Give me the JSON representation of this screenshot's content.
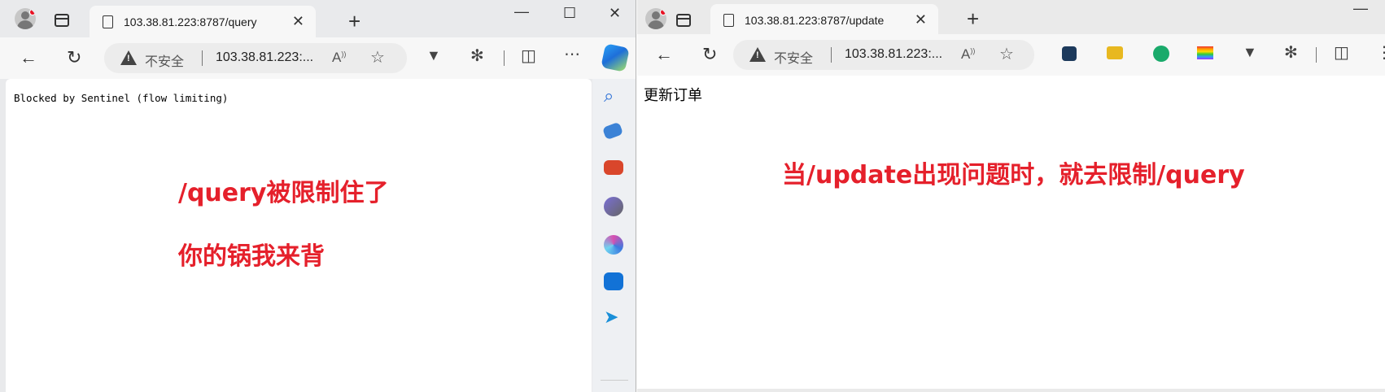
{
  "left_window": {
    "tab_title": "103.38.81.223:8787/query",
    "tab_close": "✕",
    "new_tab": "+",
    "window_controls": {
      "minimize": "—",
      "maximize": "☐",
      "close": "✕"
    },
    "address_bar": {
      "security_label": "不安全",
      "url": "103.38.81.223:...",
      "url_full": "103.38.81.223:8787/query"
    },
    "page_text": "Blocked by Sentinel (flow limiting)",
    "annotations": [
      "/query被限制住了",
      "你的锅我来背"
    ],
    "sidebar_icons": [
      "search-icon",
      "tag-icon",
      "toolbox-icon",
      "games-icon",
      "office-icon",
      "outlook-icon",
      "send-icon"
    ]
  },
  "right_window": {
    "tab_title": "103.38.81.223:8787/update",
    "tab_close": "✕",
    "new_tab": "+",
    "window_controls": {
      "minimize": "—"
    },
    "address_bar": {
      "security_label": "不安全",
      "url": "103.38.81.223:...",
      "url_full": "103.38.81.223:8787/update"
    },
    "page_text": "更新订单",
    "annotation": "当/update出现问题时，就去限制/query"
  },
  "colors": {
    "annotation_red": "#e5202b",
    "chrome_bg": "#e9eaec",
    "toolbar_bg": "#f7f7f7"
  }
}
